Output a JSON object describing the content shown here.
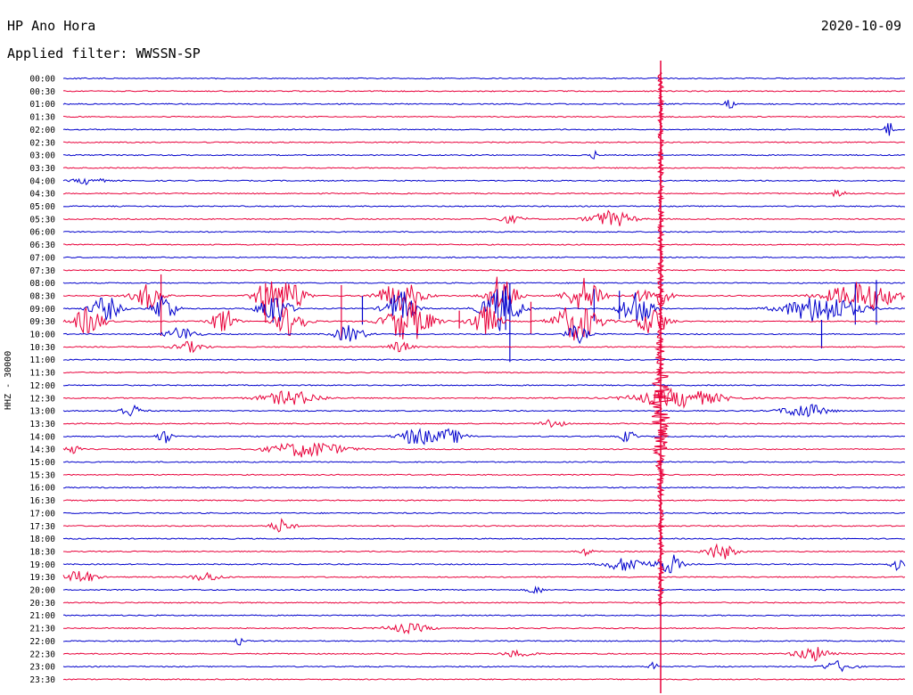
{
  "header": {
    "station": "HP Ano Hora",
    "date": "2020-10-09",
    "filter": "Applied filter: WWSSN-SP"
  },
  "chart_data": {
    "type": "line",
    "ylabel": "HHZ - 30000",
    "row_labels": [
      "00:00",
      "00:30",
      "01:00",
      "01:30",
      "02:00",
      "02:30",
      "03:00",
      "03:30",
      "04:00",
      "04:30",
      "05:00",
      "05:30",
      "06:00",
      "06:30",
      "07:00",
      "07:30",
      "08:00",
      "08:30",
      "09:00",
      "09:30",
      "10:00",
      "10:30",
      "11:00",
      "11:30",
      "12:00",
      "12:30",
      "13:00",
      "13:30",
      "14:00",
      "14:30",
      "15:00",
      "15:30",
      "16:00",
      "16:30",
      "17:00",
      "17:30",
      "18:00",
      "18:30",
      "19:00",
      "19:30",
      "20:00",
      "20:30",
      "21:00",
      "21:30",
      "22:00",
      "22:30",
      "23:00",
      "23:30"
    ],
    "minutes_per_row": 30,
    "colors": {
      "even": "#0000cc",
      "odd": "#e8003a"
    },
    "grid": false
  }
}
